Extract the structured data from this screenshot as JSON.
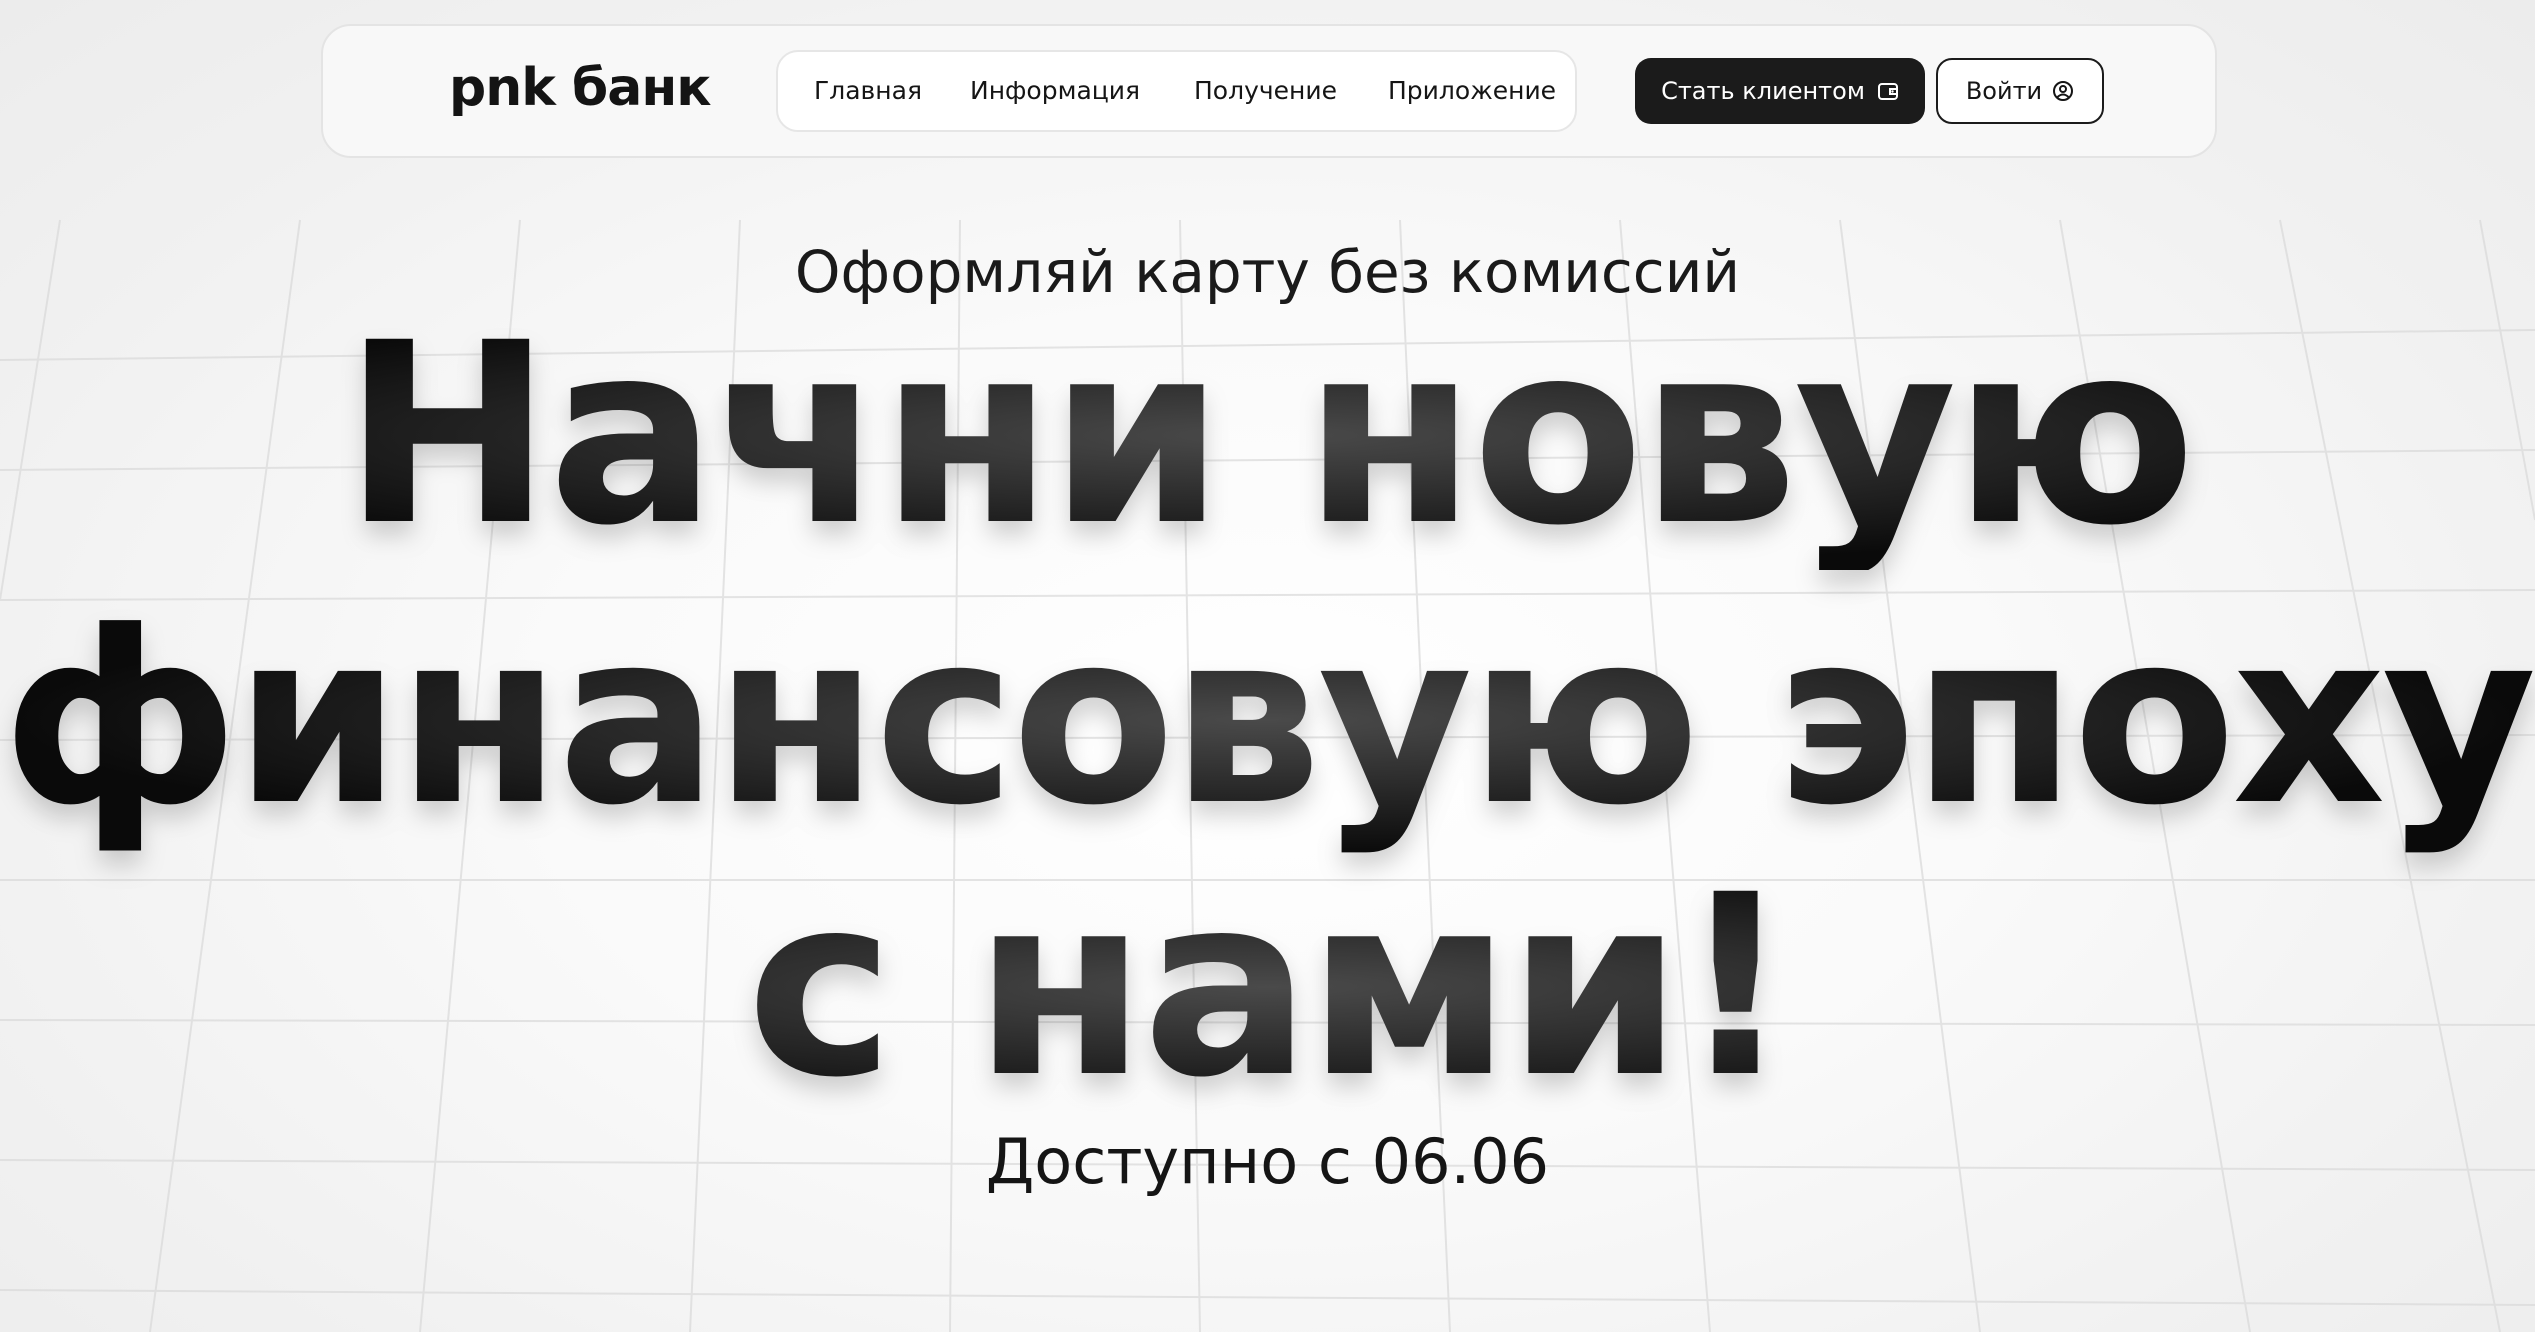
{
  "header": {
    "logo": "pnk банк",
    "nav": [
      {
        "label": "Главная"
      },
      {
        "label": "Информация"
      },
      {
        "label": "Получение"
      },
      {
        "label": "Приложение"
      }
    ],
    "become_client": {
      "label": "Стать клиентом",
      "icon": "wallet-icon"
    },
    "login": {
      "label": "Войти",
      "icon": "user-circle-icon"
    }
  },
  "hero": {
    "subtitle": "Оформляй карту без комиссий",
    "headline": [
      "Начни новую",
      "финансовую эпоху",
      "с нами!"
    ],
    "available": "Доступно с 06.06"
  }
}
